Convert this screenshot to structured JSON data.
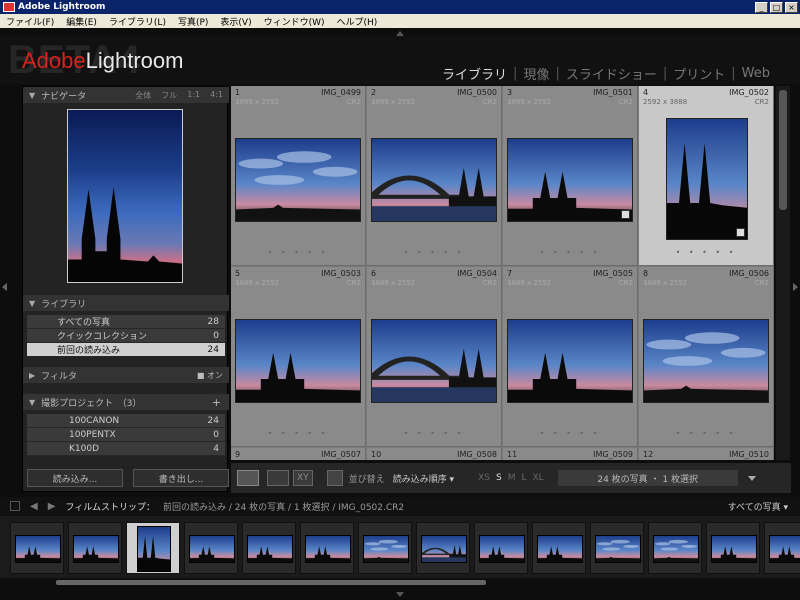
{
  "window": {
    "title": "Adobe Lightroom",
    "min": "_",
    "max": "□",
    "close": "×"
  },
  "menu": [
    "ファイル(F)",
    "編集(E)",
    "ライブラリ(L)",
    "写真(P)",
    "表示(V)",
    "ウィンドウ(W)",
    "ヘルプ(H)"
  ],
  "logo": {
    "beta": "BETA4",
    "adobe": "Adobe",
    "lightroom": "Lightroom"
  },
  "modules": [
    "ライブラリ",
    "現像",
    "スライドショー",
    "プリント",
    "Web"
  ],
  "navigator": {
    "title": "ナビゲータ",
    "options": [
      "全体",
      "フル",
      "1:1",
      "4:1"
    ]
  },
  "library": {
    "title": "ライブラリ",
    "items": [
      {
        "label": "すべての写真",
        "count": "28"
      },
      {
        "label": "クイックコレクション",
        "count": "0"
      },
      {
        "label": "前回の読み込み",
        "count": "24"
      }
    ]
  },
  "filter": {
    "title": "フィルタ",
    "toggle": "■ オン"
  },
  "projects": {
    "title": "撮影プロジェクト　（3）",
    "add": "+",
    "items": [
      {
        "label": "100CANON",
        "count": "24"
      },
      {
        "label": "100PENTX",
        "count": "0"
      },
      {
        "label": "K100D",
        "count": "4"
      }
    ]
  },
  "buttons": {
    "import": "読み込み...",
    "export": "書き出し..."
  },
  "grid": {
    "cells": [
      {
        "num": "1",
        "name": "IMG_0499",
        "dims": "3888 x 2592",
        "ext": "CR2",
        "scene": "clouds",
        "dots": "• • • • •"
      },
      {
        "num": "2",
        "name": "IMG_0500",
        "dims": "3888 x 2592",
        "ext": "CR2",
        "scene": "bridge",
        "dots": "• • • • •"
      },
      {
        "num": "3",
        "name": "IMG_0501",
        "dims": "3888 x 2592",
        "ext": "CR2",
        "scene": "cathedral",
        "dots": "• • • • •"
      },
      {
        "num": "4",
        "name": "IMG_0502",
        "dims": "2592 x 3888",
        "ext": "CR2",
        "scene": "portrait",
        "dots": "• • • • •"
      },
      {
        "num": "5",
        "name": "IMG_0503",
        "dims": "3888 x 2592",
        "ext": "CR2",
        "scene": "cathedral",
        "dots": "• • • • •"
      },
      {
        "num": "6",
        "name": "IMG_0504",
        "dims": "3888 x 2592",
        "ext": "CR2",
        "scene": "bridge",
        "dots": "• • • • •"
      },
      {
        "num": "7",
        "name": "IMG_0505",
        "dims": "3888 x 2592",
        "ext": "CR2",
        "scene": "cathedral",
        "dots": "• • • • •"
      },
      {
        "num": "8",
        "name": "IMG_0506",
        "dims": "3888 x 2592",
        "ext": "CR2",
        "scene": "clouds",
        "dots": "• • • • •"
      },
      {
        "num": "9",
        "name": "IMG_0507",
        "dims": "",
        "ext": "",
        "scene": "none",
        "dots": ""
      },
      {
        "num": "10",
        "name": "IMG_0508",
        "dims": "",
        "ext": "",
        "scene": "none",
        "dots": ""
      },
      {
        "num": "11",
        "name": "IMG_0509",
        "dims": "",
        "ext": "",
        "scene": "none",
        "dots": ""
      },
      {
        "num": "12",
        "name": "IMG_0510",
        "dims": "",
        "ext": "",
        "scene": "none",
        "dots": ""
      }
    ],
    "selected": 3
  },
  "toolbar": {
    "xy": "XY",
    "sort_label": "並び替え",
    "sort_value": "読み込み順序 ▾",
    "sizes": [
      "XS",
      "S",
      "M",
      "L",
      "XL"
    ],
    "count": "24 枚の写真 ・ 1 枚選択"
  },
  "filmstrip": {
    "label": "フィルムストリップ：",
    "path": "前回の読み込み / 24 枚の写真 / 1 枚選択 / IMG_0502.CR2",
    "filter": "すべての写真 ▾",
    "thumbs": [
      "cathedral",
      "cathedral",
      "portrait",
      "cathedral",
      "cathedral",
      "cathedral",
      "clouds",
      "bridge",
      "cathedral",
      "cathedral",
      "clouds",
      "clouds",
      "cathedral",
      "cathedral"
    ],
    "selected": 2
  },
  "colors": {
    "accent": "#d8221c",
    "panel": "#232323",
    "grid": "#7a7a7a"
  }
}
